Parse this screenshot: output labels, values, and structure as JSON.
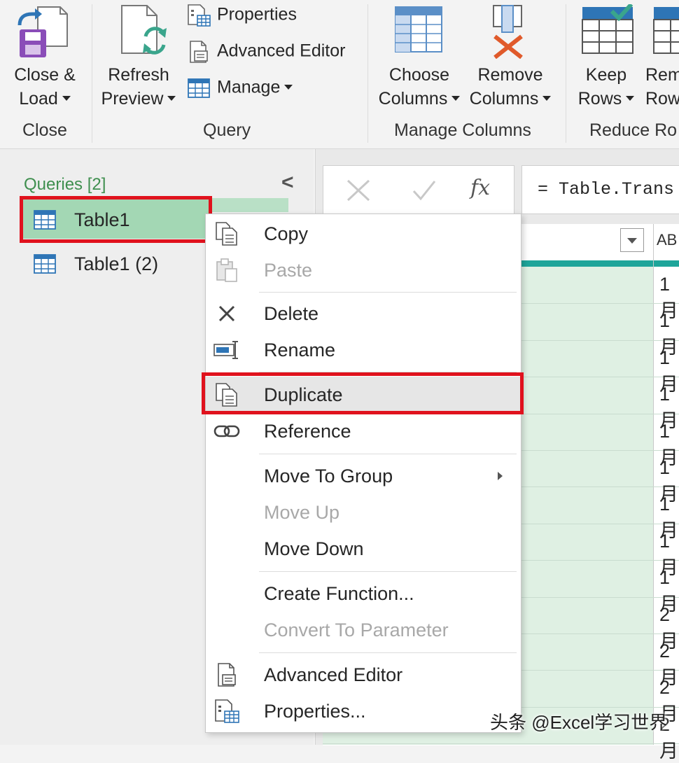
{
  "ribbon": {
    "close_group": {
      "button_line1": "Close &",
      "button_line2": "Load",
      "group_label": "Close"
    },
    "query_group": {
      "refresh_line1": "Refresh",
      "refresh_line2": "Preview",
      "properties": "Properties",
      "advanced_editor": "Advanced Editor",
      "manage": "Manage",
      "group_label": "Query"
    },
    "manage_columns_group": {
      "choose_line1": "Choose",
      "choose_line2": "Columns",
      "remove_line1": "Remove",
      "remove_line2": "Columns",
      "group_label": "Manage Columns"
    },
    "reduce_rows_group": {
      "keep_line1": "Keep",
      "keep_line2": "Rows",
      "remove_line1": "Rem",
      "remove_line2": "Row",
      "group_label": "Reduce Ro"
    }
  },
  "queries": {
    "header": "Queries [2]",
    "collapse_glyph": "<",
    "items": [
      {
        "label": "Table1"
      },
      {
        "label": "Table1 (2)"
      }
    ]
  },
  "formula_bar": {
    "fx_glyph": "fx",
    "formula": "= Table.Trans"
  },
  "grid": {
    "type_glyph": "AB",
    "cells": [
      "1月",
      "1月",
      "1月",
      "1月",
      "1月",
      "1月",
      "1月",
      "1月",
      "1月",
      "2月",
      "2月",
      "2月",
      "2月"
    ]
  },
  "context_menu": {
    "items": [
      {
        "label": "Copy"
      },
      {
        "label": "Paste"
      },
      {
        "label": "Delete"
      },
      {
        "label": "Rename"
      },
      {
        "label": "Duplicate"
      },
      {
        "label": "Reference"
      },
      {
        "label": "Move To Group"
      },
      {
        "label": "Move Up"
      },
      {
        "label": "Move Down"
      },
      {
        "label": "Create Function..."
      },
      {
        "label": "Convert To Parameter"
      },
      {
        "label": "Advanced Editor"
      },
      {
        "label": "Properties..."
      }
    ]
  },
  "watermark": "头条 @Excel学习世界",
  "colors": {
    "highlight_red": "#e0121d",
    "selected_green": "#9fd4b0",
    "teal_bar": "#1ea59a",
    "queries_header": "#3f8f4f"
  }
}
